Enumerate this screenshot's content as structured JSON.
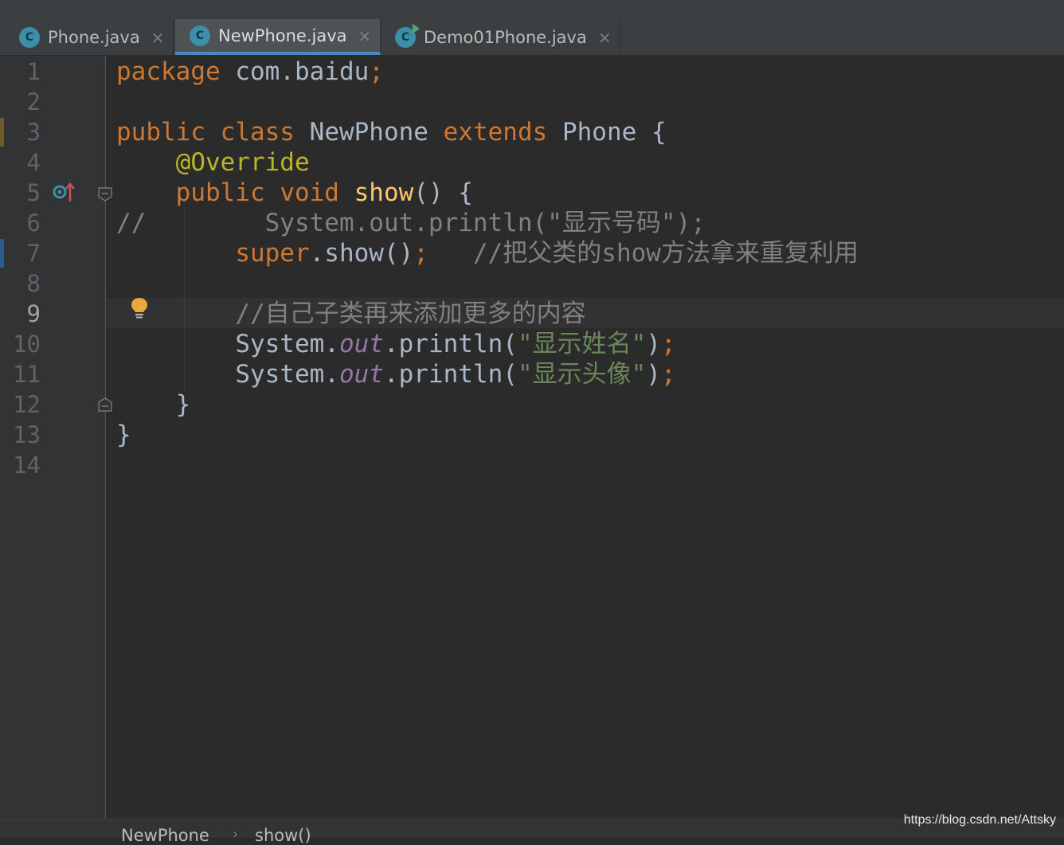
{
  "tabs": [
    {
      "label": "Phone.java",
      "icon": "class-icon",
      "active": false
    },
    {
      "label": "NewPhone.java",
      "icon": "class-icon",
      "active": true
    },
    {
      "label": "Demo01Phone.java",
      "icon": "runnable-class-icon",
      "active": false
    }
  ],
  "close_glyph": "×",
  "line_numbers": [
    "1",
    "2",
    "3",
    "4",
    "5",
    "6",
    "7",
    "8",
    "9",
    "10",
    "11",
    "12",
    "13",
    "14"
  ],
  "current_line": "9",
  "code": {
    "l1": {
      "kw": "package",
      "rest": " com.baidu",
      "semi": ";"
    },
    "l3": {
      "kw1": "public",
      "kw2": "class",
      "name": "NewPhone",
      "kw3": "extends",
      "rest": "Phone {"
    },
    "l4": {
      "annotation": "@Override"
    },
    "l5": {
      "kw1": "public",
      "kw2": "void",
      "method": "show",
      "rest": "() {"
    },
    "l6": {
      "comment": "//        System.out.println(\"显示号码\");"
    },
    "l7": {
      "kw": "super",
      "rest": ".show()",
      "semi": ";",
      "comment": "//把父类的show方法拿来重复利用"
    },
    "l9": {
      "comment": "//自己子类再来添加更多的内容"
    },
    "l10": {
      "obj": "System.",
      "field": "out",
      "call": ".println(",
      "str": "\"显示姓名\"",
      "close": ")",
      "semi": ";"
    },
    "l11": {
      "obj": "System.",
      "field": "out",
      "call": ".println(",
      "str": "\"显示头像\"",
      "close": ")",
      "semi": ";"
    },
    "l12": {
      "brace": "}"
    },
    "l13": {
      "brace": "}"
    }
  },
  "breadcrumb": {
    "class": "NewPhone",
    "method": "show()",
    "separator": "›"
  },
  "watermark": "https://blog.csdn.net/Attsky",
  "colors": {
    "keyword": "#cc7832",
    "annotation": "#bbb529",
    "method": "#ffc66d",
    "string": "#6a8759",
    "field": "#9876aa",
    "comment": "#808080",
    "text": "#a9b7c6",
    "background": "#2b2b2b"
  }
}
